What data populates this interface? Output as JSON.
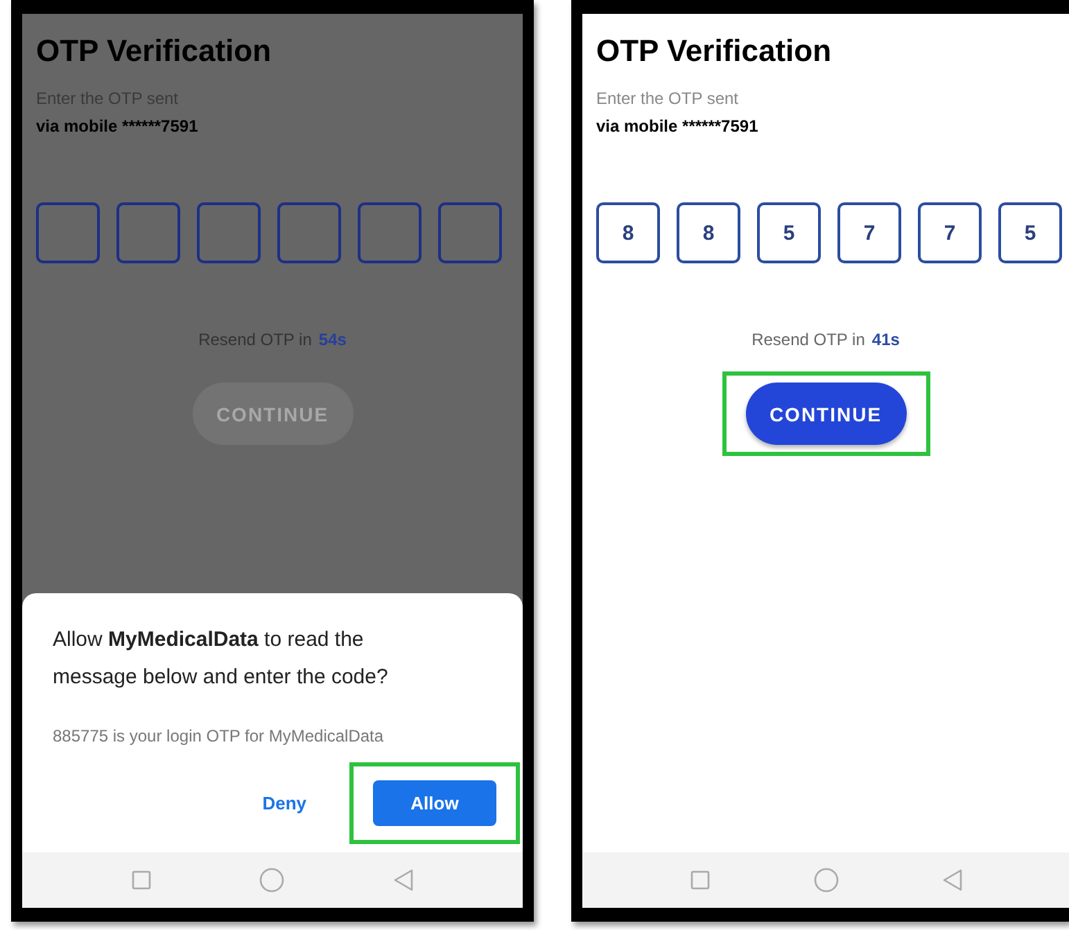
{
  "screens": [
    {
      "dimmed": true,
      "title": "OTP Verification",
      "instruction": "Enter the OTP sent",
      "destination": "via mobile ******7591",
      "otp_boxes": [
        {
          "filled": false
        },
        {
          "filled": false
        },
        {
          "filled": false
        },
        {
          "filled": false
        },
        {
          "filled": false
        },
        {
          "filled": false
        }
      ],
      "resend": {
        "label": "Resend OTP in",
        "countdown": "54s"
      },
      "continue_button": {
        "label": "CONTINUE",
        "disabled": true,
        "highlighted": false
      },
      "dialog": {
        "message": "Allow **MyMedicalData** to read the message below and enter the code?",
        "sms": "885775 is your login OTP for MyMedicalData",
        "buttons": [
          {
            "label": "Deny",
            "kind": "text",
            "highlighted": false
          },
          {
            "label": "Allow",
            "kind": "filled",
            "highlighted": true
          }
        ]
      }
    },
    {
      "dimmed": false,
      "title": "OTP Verification",
      "instruction": "Enter the OTP sent",
      "destination": "via mobile ******7591",
      "otp_boxes": [
        {
          "filled": true,
          "digit": "8"
        },
        {
          "filled": true,
          "digit": "8"
        },
        {
          "filled": true,
          "digit": "5"
        },
        {
          "filled": true,
          "digit": "7"
        },
        {
          "filled": true,
          "digit": "7"
        },
        {
          "filled": true,
          "digit": "5"
        }
      ],
      "resend": {
        "label": "Resend OTP in",
        "countdown": "41s"
      },
      "continue_button": {
        "label": "CONTINUE",
        "disabled": false,
        "highlighted": true
      }
    }
  ]
}
